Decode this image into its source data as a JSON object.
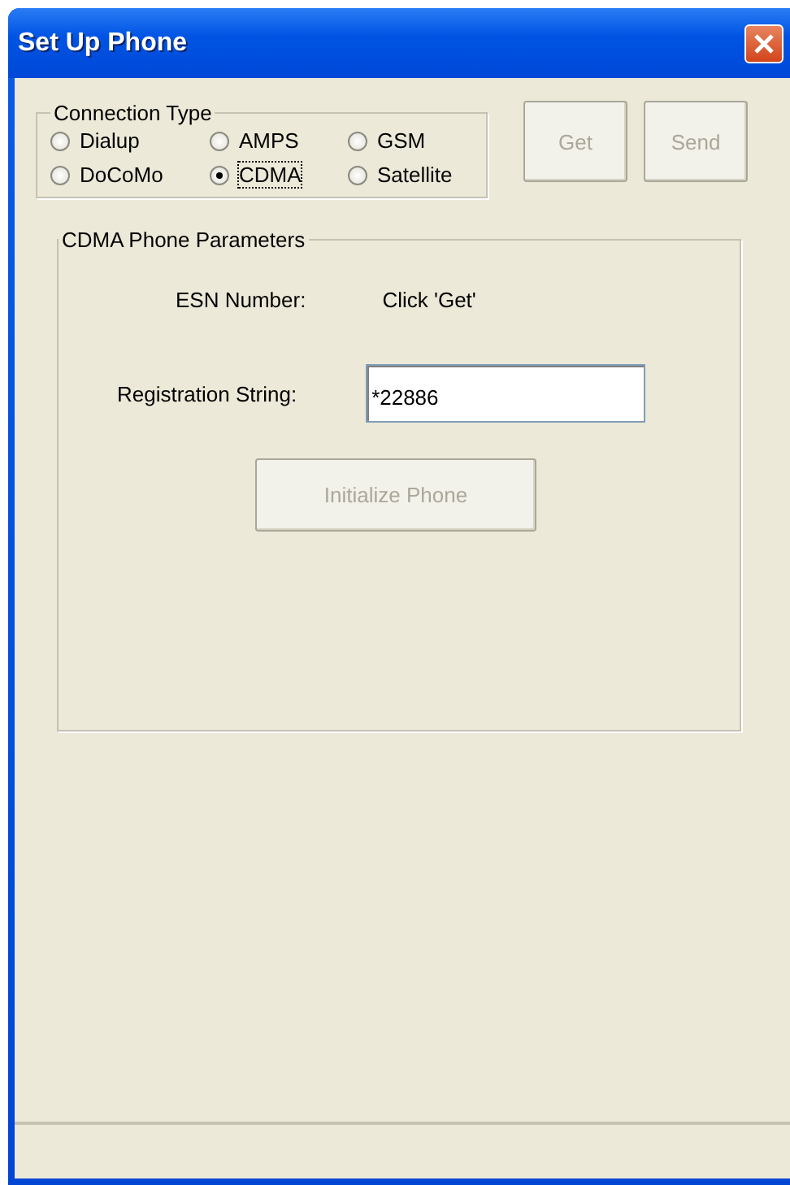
{
  "window": {
    "title": "Set Up Phone"
  },
  "connection_type": {
    "label": "Connection Type",
    "options": [
      {
        "label": "Dialup",
        "selected": false
      },
      {
        "label": "AMPS",
        "selected": false
      },
      {
        "label": "GSM",
        "selected": false
      },
      {
        "label": "DoCoMo",
        "selected": false
      },
      {
        "label": "CDMA",
        "selected": true
      },
      {
        "label": "Satellite",
        "selected": false
      }
    ]
  },
  "buttons": [
    {
      "label": "Get",
      "disabled": true
    },
    {
      "label": "Send",
      "disabled": true
    }
  ],
  "parameters": {
    "label": "CDMA Phone Parameters",
    "esn_label": "ESN Number:",
    "esn_value": "Click 'Get'",
    "registration_label": "Registration String:",
    "registration_value": "*22886",
    "initialize_button": {
      "label": "Initialize Phone",
      "disabled": true
    }
  }
}
